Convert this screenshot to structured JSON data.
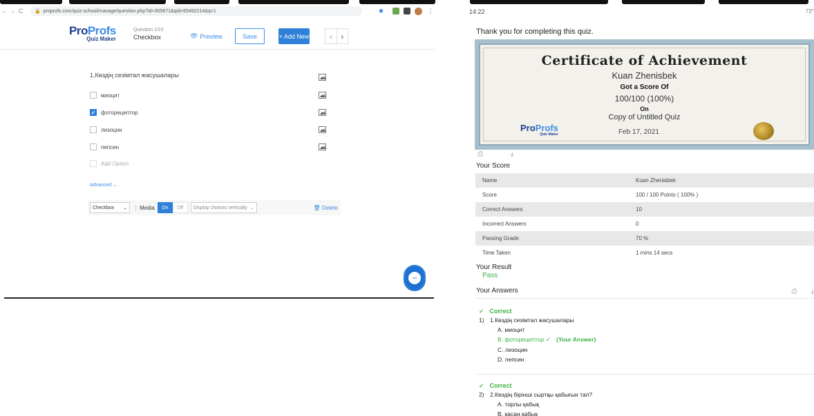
{
  "browser": {
    "url": "proprofs.com/quiz-school/manage/question.php?id=305671&qid=65492214&q=1",
    "nav_back": "←",
    "nav_forward": "→",
    "nav_reload": "C"
  },
  "editor": {
    "logo_pro": "Pro",
    "logo_profs": "Profs",
    "logo_sub": "Quiz Maker",
    "question_num": "Question 1/10",
    "question_type": "Checkbox",
    "preview_label": "Preview",
    "save_label": "Save",
    "add_new_label": "+ Add New",
    "question_text": "1.Көздің сезімтал жасушалары",
    "options": [
      {
        "label": "миоцит",
        "checked": false
      },
      {
        "label": "фоторецептор",
        "checked": true
      },
      {
        "label": "лизоцин",
        "checked": false
      },
      {
        "label": "пепсин",
        "checked": false
      }
    ],
    "add_option_label": "Add Option",
    "advanced_label": "Advanced",
    "type_select": "Checkbox",
    "media_label": "Media",
    "media_on": "On",
    "media_off": "Off",
    "display_select": "Display choices vertically",
    "delete_label": "Delete"
  },
  "mobile": {
    "status_time": "14:22",
    "status_right": "72°",
    "thanks": "Thank you for completing this quiz.",
    "certificate": {
      "title": "Certificate of Achievement",
      "name": "Kuan Zhenisbek",
      "got_score": "Got a Score Of",
      "score": "100/100 (100%)",
      "on": "On",
      "quiz": "Copy of Untitled Quiz",
      "date": "Feb 17, 2021",
      "logo_pro": "Pro",
      "logo_profs": "Profs",
      "logo_sub": "Quiz Maker"
    },
    "your_score_label": "Your Score",
    "score_rows": [
      {
        "key": "Name",
        "value": "Kuan Zhenisbek"
      },
      {
        "key": "Score",
        "value": "100 / 100   Points ( 100% )"
      },
      {
        "key": "Correct Answers",
        "value": "10"
      },
      {
        "key": "Incorrect Answers",
        "value": "0"
      },
      {
        "key": "Passing Grade",
        "value": "70 %"
      },
      {
        "key": "Time Taken",
        "value": "1 mins 14 secs"
      }
    ],
    "your_result_label": "Your Result",
    "result": "Pass",
    "your_answers_label": "Your Answers",
    "answers": [
      {
        "status": "Correct",
        "num": "1)",
        "question": "1.Көздің сезімтал жасушалары",
        "choices": [
          {
            "text": "A. миоцит",
            "selected": false
          },
          {
            "text": "B. фоторецептор",
            "selected": true,
            "tag": "(Your Answer)"
          },
          {
            "text": "C. лизоцин",
            "selected": false
          },
          {
            "text": "D. пепсин",
            "selected": false
          }
        ]
      },
      {
        "status": "Correct",
        "num": "2)",
        "question": "2.Көздің бірінші сыртқы қабығын тап?",
        "choices": [
          {
            "text": "A. торлы қабық",
            "selected": false
          },
          {
            "text": "B. қасаң қабық",
            "selected": false
          }
        ]
      }
    ]
  }
}
